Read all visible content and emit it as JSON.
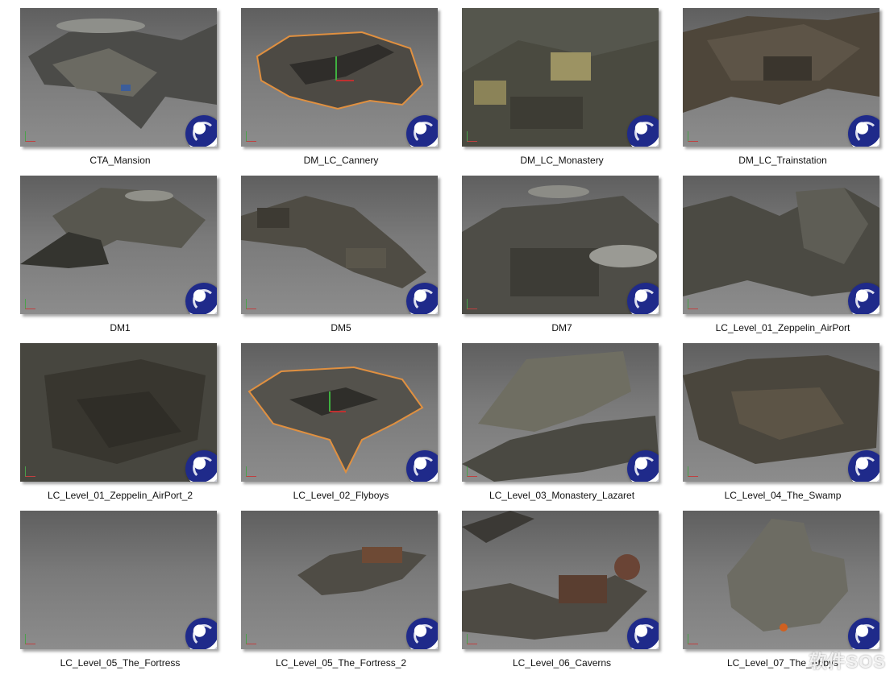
{
  "gallery": {
    "items": [
      {
        "label": "CTA_Mansion",
        "icon": "cinema4d-icon"
      },
      {
        "label": "DM_LC_Cannery",
        "icon": "cinema4d-icon"
      },
      {
        "label": "DM_LC_Monastery",
        "icon": "cinema4d-icon"
      },
      {
        "label": "DM_LC_Trainstation",
        "icon": "cinema4d-icon"
      },
      {
        "label": "DM1",
        "icon": "cinema4d-icon"
      },
      {
        "label": "DM5",
        "icon": "cinema4d-icon"
      },
      {
        "label": "DM7",
        "icon": "cinema4d-icon"
      },
      {
        "label": "LC_Level_01_Zeppelin_AirPort",
        "icon": "cinema4d-icon"
      },
      {
        "label": "LC_Level_01_Zeppelin_AirPort_2",
        "icon": "cinema4d-icon"
      },
      {
        "label": "LC_Level_02_Flyboys",
        "icon": "cinema4d-icon"
      },
      {
        "label": "LC_Level_03_Monastery_Lazaret",
        "icon": "cinema4d-icon"
      },
      {
        "label": "LC_Level_04_The_Swamp",
        "icon": "cinema4d-icon"
      },
      {
        "label": "LC_Level_05_The_Fortress",
        "icon": "cinema4d-icon"
      },
      {
        "label": "LC_Level_05_The_Fortress_2",
        "icon": "cinema4d-icon"
      },
      {
        "label": "LC_Level_06_Caverns",
        "icon": "cinema4d-icon"
      },
      {
        "label": "LC_Level_07_The_Abbys",
        "icon": "cinema4d-icon"
      }
    ]
  },
  "watermark": {
    "text": "软件SOS"
  }
}
